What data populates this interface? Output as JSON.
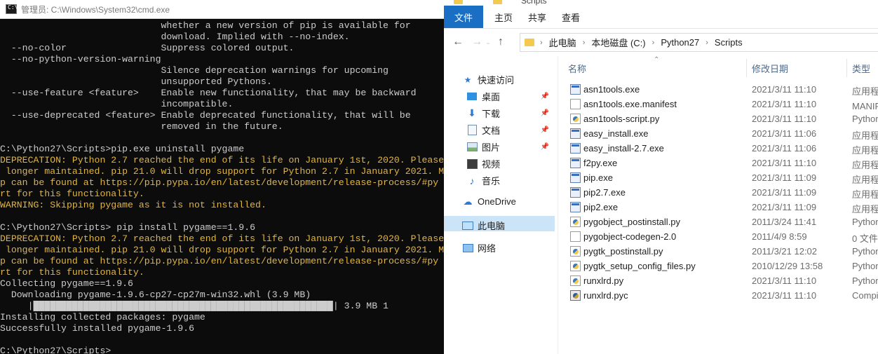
{
  "cmd": {
    "title": "管理员: C:\\Windows\\System32\\cmd.exe",
    "lines": [
      {
        "text": "                             whether a new version of pip is available for",
        "style": "n"
      },
      {
        "text": "                             download. Implied with --no-index.",
        "style": "n"
      },
      {
        "text": "  --no-color                 Suppress colored output.",
        "style": "n"
      },
      {
        "text": "  --no-python-version-warning",
        "style": "n"
      },
      {
        "text": "                             Silence deprecation warnings for upcoming",
        "style": "n"
      },
      {
        "text": "                             unsupported Pythons.",
        "style": "n"
      },
      {
        "text": "  --use-feature <feature>    Enable new functionality, that may be backward",
        "style": "n"
      },
      {
        "text": "                             incompatible.",
        "style": "n"
      },
      {
        "text": "  --use-deprecated <feature> Enable deprecated functionality, that will be",
        "style": "n"
      },
      {
        "text": "                             removed in the future.",
        "style": "n"
      },
      {
        "text": "",
        "style": "n"
      },
      {
        "text": "C:\\Python27\\Scripts>pip.exe uninstall pygame",
        "style": "n"
      },
      {
        "text": "DEPRECATION: Python 2.7 reached the end of its life on January 1st, 2020. Please",
        "style": "y"
      },
      {
        "text": " longer maintained. pip 21.0 will drop support for Python 2.7 in January 2021. M",
        "style": "y"
      },
      {
        "text": "p can be found at https://pip.pypa.io/en/latest/development/release-process/#py",
        "style": "y"
      },
      {
        "text": "rt for this functionality.",
        "style": "y"
      },
      {
        "text": "WARNING: Skipping pygame as it is not installed.",
        "style": "y"
      },
      {
        "text": "",
        "style": "n"
      },
      {
        "text": "C:\\Python27\\Scripts> pip install pygame==1.9.6",
        "style": "n"
      },
      {
        "text": "DEPRECATION: Python 2.7 reached the end of its life on January 1st, 2020. Please",
        "style": "y"
      },
      {
        "text": " longer maintained. pip 21.0 will drop support for Python 2.7 in January 2021. M",
        "style": "y"
      },
      {
        "text": "p can be found at https://pip.pypa.io/en/latest/development/release-process/#py",
        "style": "y"
      },
      {
        "text": "rt for this functionality.",
        "style": "y"
      },
      {
        "text": "Collecting pygame==1.9.6",
        "style": "n"
      },
      {
        "text": "  Downloading pygame-1.9.6-cp27-cp27m-win32.whl (3.9 MB)",
        "style": "n"
      },
      {
        "text": "     |██████████████████████████████████████████████████████| 3.9 MB 1",
        "style": "n"
      },
      {
        "text": "Installing collected packages: pygame",
        "style": "n"
      },
      {
        "text": "Successfully installed pygame-1.9.6",
        "style": "n"
      },
      {
        "text": "",
        "style": "n"
      },
      {
        "text": "C:\\Python27\\Scripts>",
        "style": "n"
      }
    ]
  },
  "explorer": {
    "window_title": "Scripts",
    "ribbon_tabs": [
      "文件",
      "主页",
      "共享",
      "查看"
    ],
    "breadcrumb": [
      "此电脑",
      "本地磁盘 (C:)",
      "Python27",
      "Scripts"
    ],
    "nav_items": [
      {
        "label": "快速访问",
        "icon": "star-icon"
      },
      {
        "label": "桌面",
        "icon": "desktop-icon",
        "pinned": true
      },
      {
        "label": "下载",
        "icon": "download-icon",
        "pinned": true
      },
      {
        "label": "文档",
        "icon": "document-icon",
        "pinned": true
      },
      {
        "label": "图片",
        "icon": "picture-icon",
        "pinned": true
      },
      {
        "label": "视频",
        "icon": "video-icon"
      },
      {
        "label": "音乐",
        "icon": "music-icon"
      },
      {
        "label": "OneDrive",
        "icon": "cloud-icon"
      },
      {
        "label": "此电脑",
        "icon": "computer-icon",
        "selected": true
      },
      {
        "label": "网络",
        "icon": "network-icon"
      }
    ],
    "columns": {
      "name": "名称",
      "date": "修改日期",
      "type": "类型"
    },
    "files": [
      {
        "name": "asn1tools.exe",
        "date": "2021/3/11 11:10",
        "type": "应用程序",
        "icon": "exe"
      },
      {
        "name": "asn1tools.exe.manifest",
        "date": "2021/3/11 11:10",
        "type": "MANIFEST 文件",
        "icon": "doc"
      },
      {
        "name": "asn1tools-script.py",
        "date": "2021/3/11 11:10",
        "type": "Python File",
        "icon": "py"
      },
      {
        "name": "easy_install.exe",
        "date": "2021/3/11 11:06",
        "type": "应用程序",
        "icon": "exe"
      },
      {
        "name": "easy_install-2.7.exe",
        "date": "2021/3/11 11:06",
        "type": "应用程序",
        "icon": "exe"
      },
      {
        "name": "f2py.exe",
        "date": "2021/3/11 11:10",
        "type": "应用程序",
        "icon": "exe"
      },
      {
        "name": "pip.exe",
        "date": "2021/3/11 11:09",
        "type": "应用程序",
        "icon": "exe"
      },
      {
        "name": "pip2.7.exe",
        "date": "2021/3/11 11:09",
        "type": "应用程序",
        "icon": "exe"
      },
      {
        "name": "pip2.exe",
        "date": "2021/3/11 11:09",
        "type": "应用程序",
        "icon": "exe"
      },
      {
        "name": "pygobject_postinstall.py",
        "date": "2011/3/24 11:41",
        "type": "Python File",
        "icon": "py"
      },
      {
        "name": "pygobject-codegen-2.0",
        "date": "2011/4/9 8:59",
        "type": "0 文件",
        "icon": "doc"
      },
      {
        "name": "pygtk_postinstall.py",
        "date": "2011/3/21 12:02",
        "type": "Python File",
        "icon": "py"
      },
      {
        "name": "pygtk_setup_config_files.py",
        "date": "2010/12/29 13:58",
        "type": "Python File",
        "icon": "py"
      },
      {
        "name": "runxlrd.py",
        "date": "2021/3/11 11:10",
        "type": "Python File",
        "icon": "py"
      },
      {
        "name": "runxlrd.pyc",
        "date": "2021/3/11 11:10",
        "type": "Compiled Python File",
        "icon": "pyc"
      }
    ]
  }
}
